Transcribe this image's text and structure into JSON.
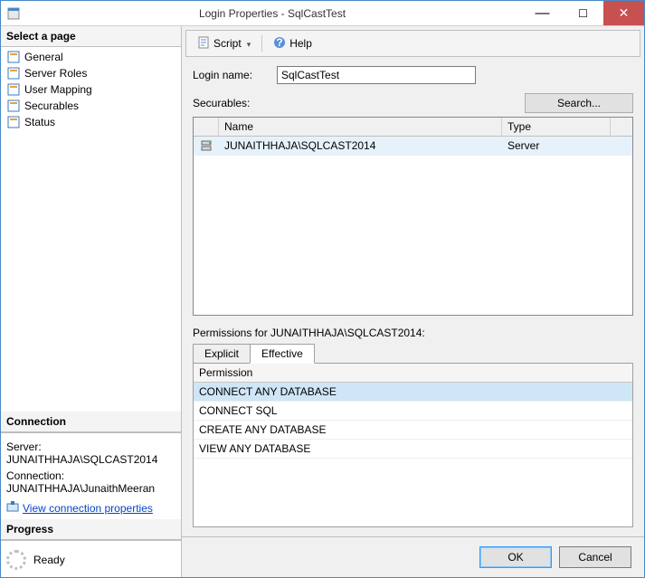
{
  "window": {
    "title": "Login Properties - SqlCastTest"
  },
  "left": {
    "select_page": "Select a page",
    "pages": [
      "General",
      "Server Roles",
      "User Mapping",
      "Securables",
      "Status"
    ],
    "connection_header": "Connection",
    "server_label": "Server:",
    "server_value": "JUNAITHHAJA\\SQLCAST2014",
    "connection_label": "Connection:",
    "connection_value": "JUNAITHHAJA\\JunaithMeeran",
    "view_conn_props": "View connection properties",
    "progress_header": "Progress",
    "progress_status": "Ready"
  },
  "toolbar": {
    "script": "Script",
    "help": "Help"
  },
  "main": {
    "login_name_label": "Login name:",
    "login_name_value": "SqlCastTest",
    "securables_label": "Securables:",
    "search_btn": "Search...",
    "grid": {
      "headers": {
        "name": "Name",
        "type": "Type"
      },
      "rows": [
        {
          "name": "JUNAITHHAJA\\SQLCAST2014",
          "type": "Server"
        }
      ]
    },
    "permissions_for": "Permissions for JUNAITHHAJA\\SQLCAST2014:",
    "tabs": {
      "explicit": "Explicit",
      "effective": "Effective"
    },
    "perm_header": "Permission",
    "perm_rows": [
      "CONNECT ANY DATABASE",
      "CONNECT SQL",
      "CREATE ANY DATABASE",
      "VIEW ANY DATABASE"
    ],
    "perm_selected_index": 0
  },
  "footer": {
    "ok": "OK",
    "cancel": "Cancel"
  }
}
